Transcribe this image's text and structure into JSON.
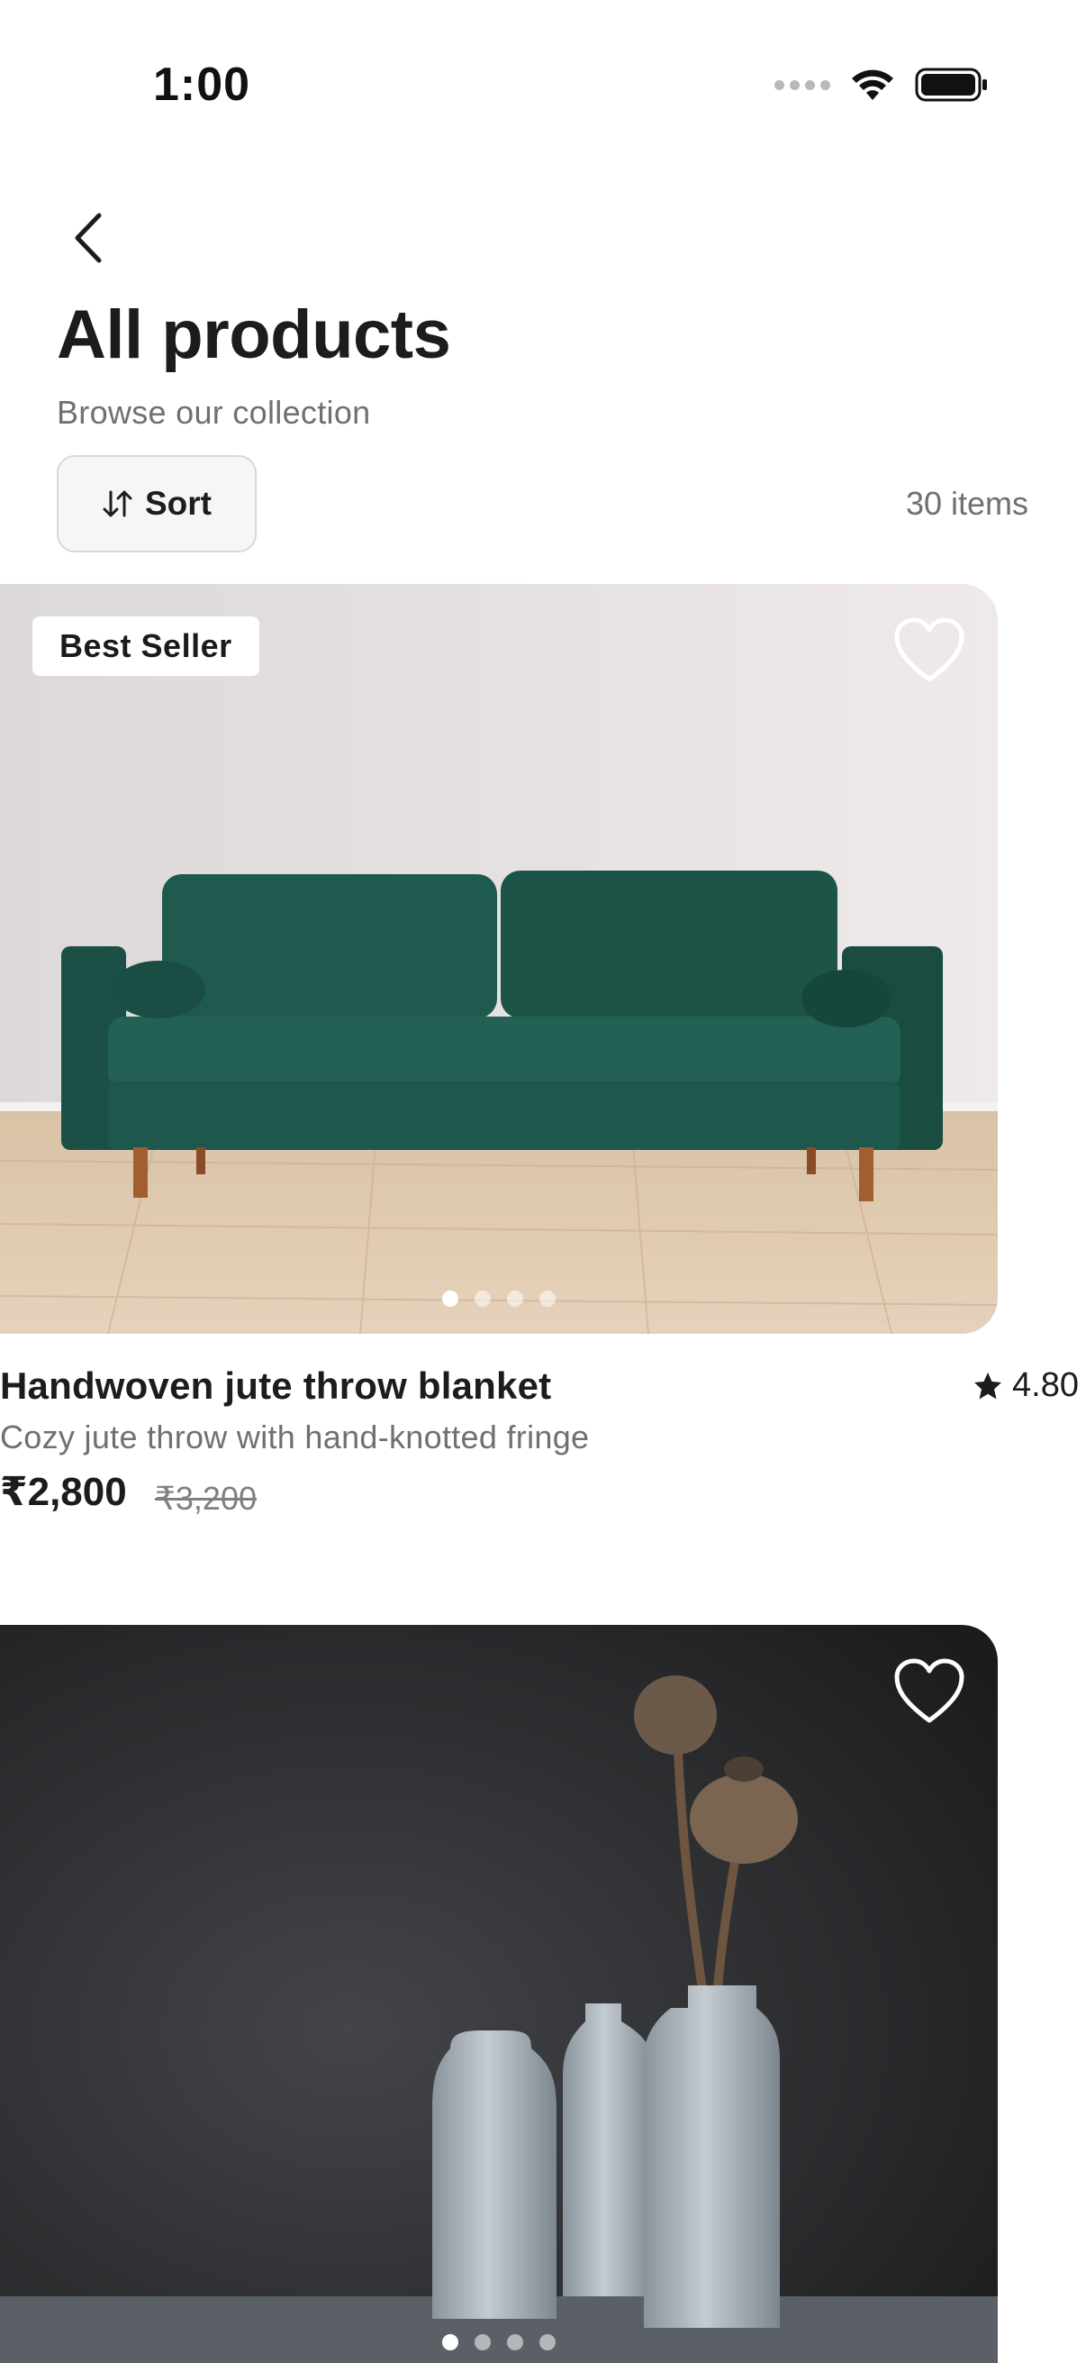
{
  "status_bar": {
    "time": "1:00"
  },
  "header": {
    "title": "All products",
    "subtitle": "Browse our collection",
    "sort_label": "Sort",
    "items_count": "30 items"
  },
  "icons": {
    "back": "chevron-left-icon",
    "sort": "sort-arrows-icon",
    "favorite": "heart-outline-icon",
    "rating": "star-icon"
  },
  "products": [
    {
      "badge": "Best Seller",
      "name": "Handwoven jute throw blanket",
      "rating": "4.80",
      "description": "Cozy jute throw with hand-knotted fringe",
      "price": "₹2,800",
      "original_price": "₹3,200",
      "image": "green velvet sofa",
      "carousel_dots": 4,
      "active_dot": 0
    },
    {
      "image": "ceramic vases with dried poppy pods",
      "carousel_dots": 4,
      "active_dot": 0
    }
  ],
  "colors": {
    "text_primary": "#1c1c1c",
    "text_secondary": "#707070",
    "sort_bg": "#f6f6f6"
  }
}
